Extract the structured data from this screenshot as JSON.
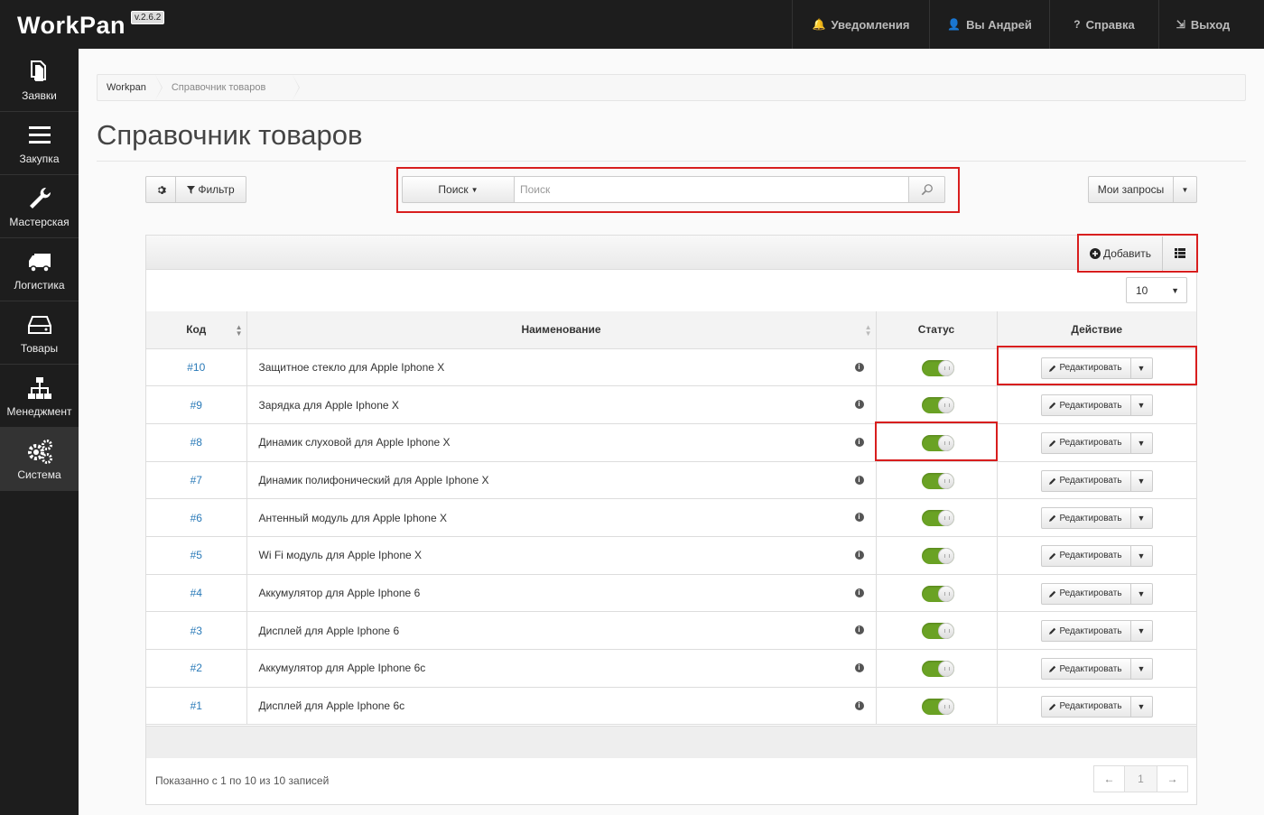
{
  "app": {
    "brand": "WorkPan",
    "version": "v.2.6.2"
  },
  "topnav": [
    {
      "icon": "bell-icon",
      "glyph": "🔔",
      "label": "Уведомления",
      "width": 152
    },
    {
      "icon": "user-icon",
      "glyph": "👤",
      "label": "Вы Андрей",
      "width": 133
    },
    {
      "icon": "help-icon",
      "glyph": "?",
      "label": "Справка",
      "width": 121
    },
    {
      "icon": "logout-icon",
      "glyph": "⇲",
      "label": "Выход",
      "width": 98
    }
  ],
  "sidebar": [
    {
      "icon": "documents-icon",
      "label": "Заявки"
    },
    {
      "icon": "menu-icon",
      "label": "Закупка"
    },
    {
      "icon": "wrench-icon",
      "label": "Мастерская"
    },
    {
      "icon": "truck-icon",
      "label": "Логистика"
    },
    {
      "icon": "drive-icon",
      "label": "Товары"
    },
    {
      "icon": "sitemap-icon",
      "label": "Менеджмент"
    },
    {
      "icon": "gears-icon",
      "label": "Система",
      "active": true
    }
  ],
  "breadcrumb": [
    "Workpan",
    "Справочник товаров"
  ],
  "page_title": "Справочник товаров",
  "toolbar": {
    "settings_icon": "gear-icon",
    "filter_label": "Фильтр"
  },
  "search": {
    "dropdown_label": "Поиск",
    "placeholder": "Поиск",
    "value": ""
  },
  "my_requests": {
    "label": "Мои запросы"
  },
  "panel": {
    "add_label": "Добавить",
    "per_page": "10"
  },
  "table": {
    "headers": {
      "code": "Код",
      "name": "Наименование",
      "status": "Статус",
      "action": "Действие"
    },
    "edit_label": "Редактировать",
    "rows": [
      {
        "code": "#10",
        "name": "Защитное стекло для Apple Iphone X",
        "active": true
      },
      {
        "code": "#9",
        "name": "Зарядка для Apple Iphone X",
        "active": true
      },
      {
        "code": "#8",
        "name": "Динамик слуховой для Apple Iphone X",
        "active": true
      },
      {
        "code": "#7",
        "name": "Динамик полифонический для Apple Iphone X",
        "active": true
      },
      {
        "code": "#6",
        "name": "Антенный модуль для Apple Iphone X",
        "active": true
      },
      {
        "code": "#5",
        "name": "Wi Fi модуль для Apple Iphone X",
        "active": true
      },
      {
        "code": "#4",
        "name": "Аккумулятор для Apple Iphone 6",
        "active": true
      },
      {
        "code": "#3",
        "name": "Дисплей для Apple Iphone 6",
        "active": true
      },
      {
        "code": "#2",
        "name": "Аккумулятор для Apple Iphone 6c",
        "active": true
      },
      {
        "code": "#1",
        "name": "Дисплей для Apple Iphone 6c",
        "active": true
      }
    ]
  },
  "footer": {
    "info": "Показанно с 1 по 10 из 10 записей",
    "pager": {
      "prev": "←",
      "page": "1",
      "next": "→"
    }
  },
  "colors": {
    "highlight": "#d81e1e",
    "link": "#2a7ab8",
    "toggle_on": "#6aa224",
    "dark": "#1d1d1d"
  }
}
